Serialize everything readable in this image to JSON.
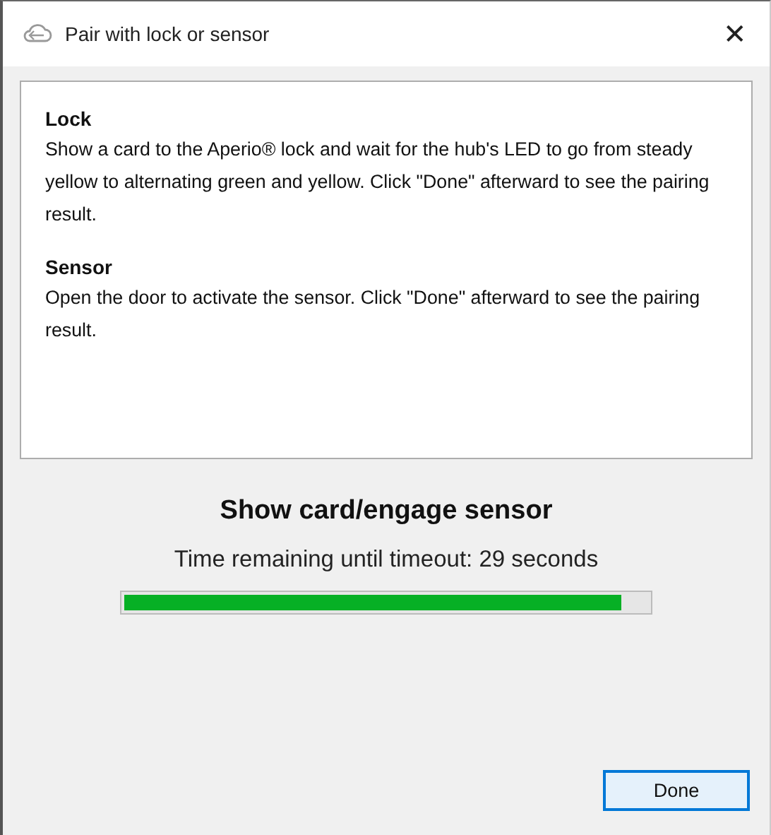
{
  "window": {
    "title": "Pair with lock or sensor",
    "close": "✕"
  },
  "instructions": [
    {
      "heading": "Lock",
      "text": "Show a card to the Aperio® lock and wait for the hub's LED to go from steady yellow to alternating green and yellow. Click \"Done\" afterward to see the pairing result."
    },
    {
      "heading": "Sensor",
      "text": "Open the door to activate the sensor. Click \"Done\" afterward to see the pairing result."
    }
  ],
  "status": {
    "heading": "Show card/engage sensor",
    "text": "Time remaining until timeout: 29 seconds",
    "level": 0.95
  },
  "buttons": [
    {
      "label": "Done",
      "default": true
    }
  ]
}
